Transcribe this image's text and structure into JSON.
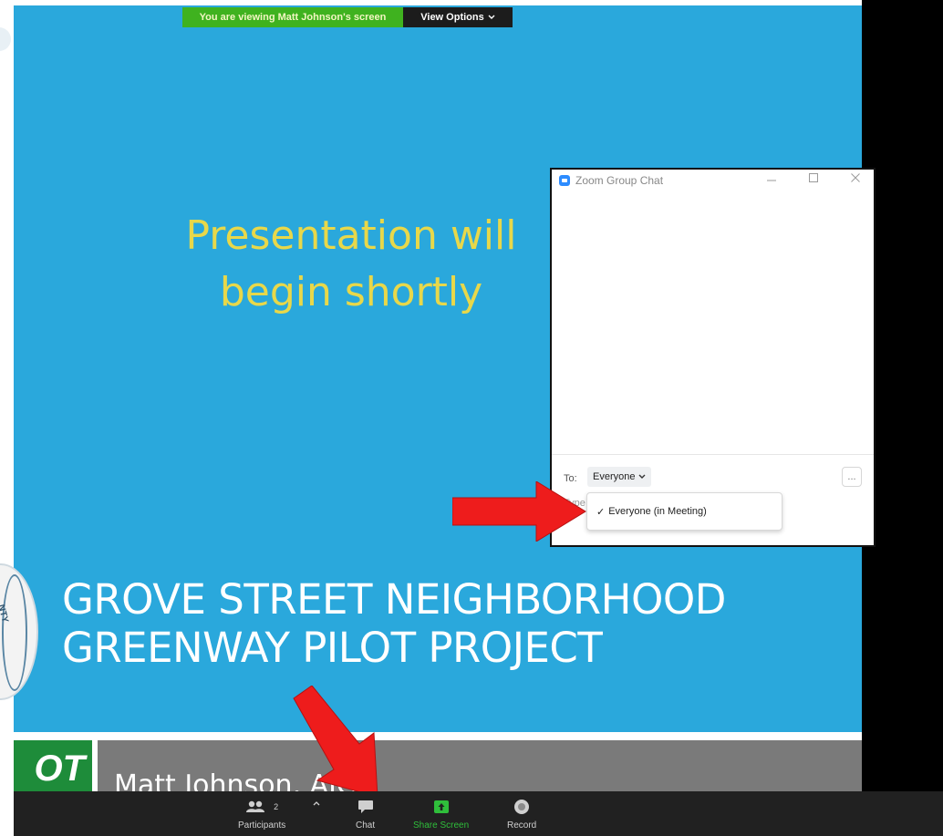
{
  "banner": {
    "viewing_text": "You are viewing Matt Johnson's screen",
    "view_options_label": "View Options",
    "banner_color": "#3fb21f"
  },
  "slide": {
    "heading_line1": "Presentation will",
    "heading_line2": "begin shortly",
    "title_line1": "GROVE STREET NEIGHBORHOOD",
    "title_line2": "GREENWAY PILOT PROJECT",
    "seal_text": "NTY",
    "logo_text": "OT",
    "presenter_name": "Matt Johnson, AICP",
    "background_color": "#2aa8dc",
    "heading_color": "#e8d84a"
  },
  "chat": {
    "window_title": "Zoom Group Chat",
    "to_label": "To:",
    "recipient": "Everyone",
    "placeholder_fragment": "Type",
    "more_label": "...",
    "dropdown_option": "Everyone (in Meeting)",
    "dropdown_check": "✓"
  },
  "toolbar": {
    "participants_label": "Participants",
    "participants_count": "2",
    "chat_label": "Chat",
    "share_label": "Share Screen",
    "record_label": "Record",
    "share_color": "#2fbe3b"
  },
  "annotations": {
    "arrow_color": "#ee1c1c"
  }
}
